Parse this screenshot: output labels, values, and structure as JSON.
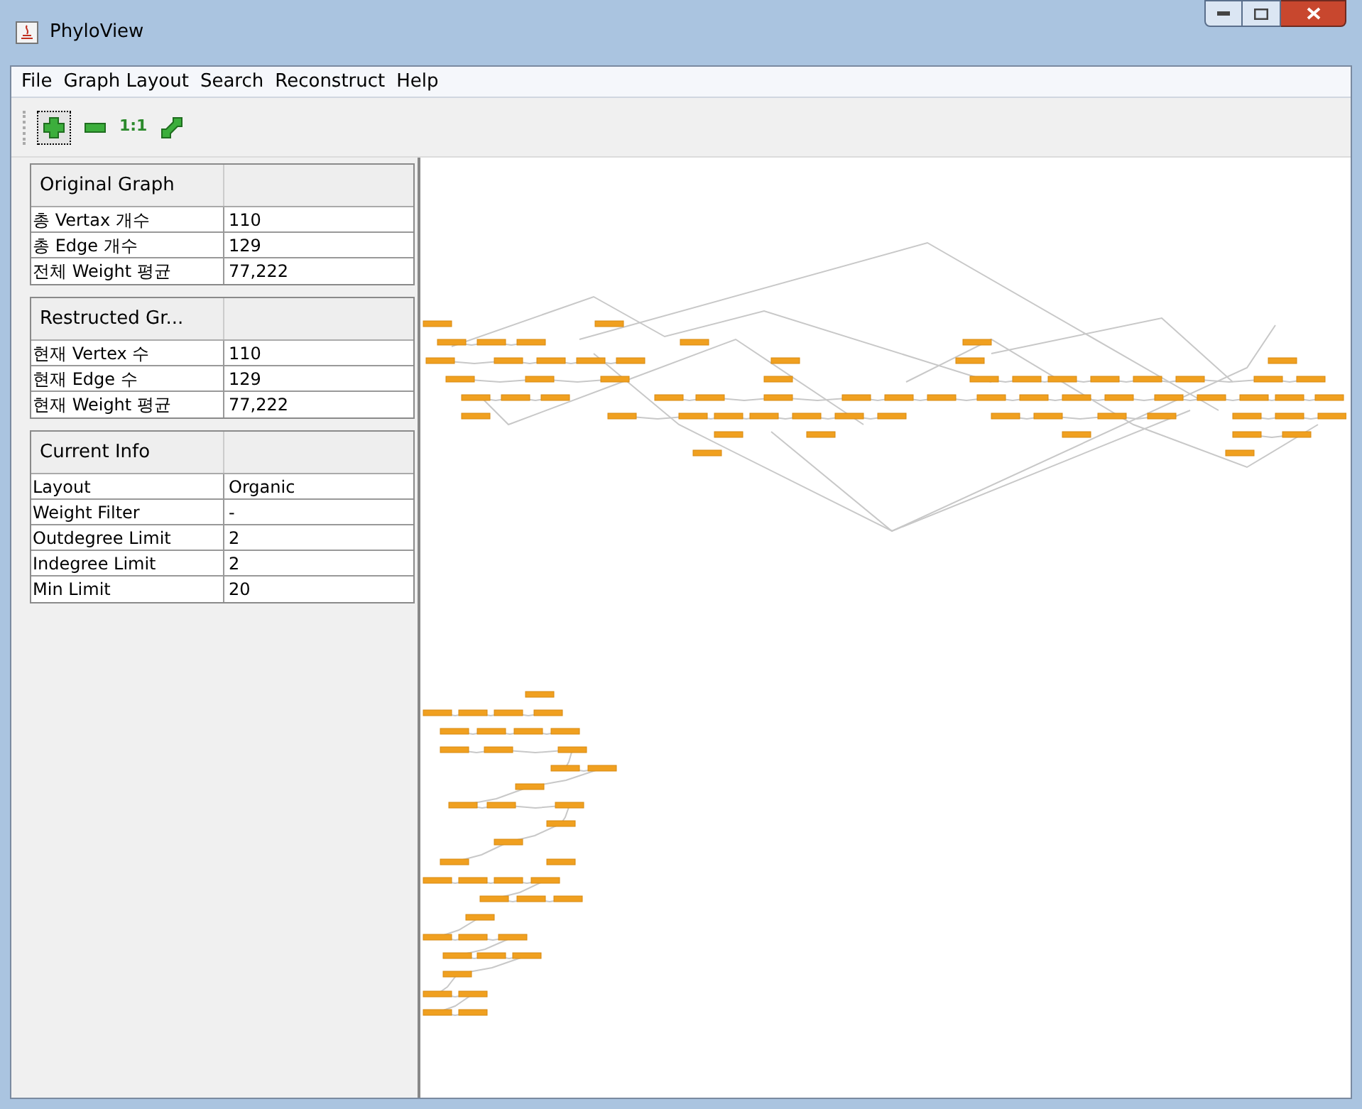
{
  "window": {
    "title": "PhyloView"
  },
  "menu": [
    "File",
    "Graph Layout",
    "Search",
    "Reconstruct",
    "Help"
  ],
  "toolbar": [
    {
      "kind": "zoom-in",
      "selected": true
    },
    {
      "kind": "zoom-out",
      "selected": false
    },
    {
      "kind": "actual-size",
      "label": "1:1",
      "selected": false
    },
    {
      "kind": "fit",
      "selected": false
    }
  ],
  "panels": [
    {
      "title": "Original Graph",
      "rows": [
        {
          "label": "총 Vertax 개수",
          "value": "110"
        },
        {
          "label": "총 Edge 개수",
          "value": "129"
        },
        {
          "label": "전체 Weight 평균",
          "value": "77,222"
        }
      ]
    },
    {
      "title": "Restructed Gr...",
      "rows": [
        {
          "label": "현재 Vertex 수",
          "value": "110"
        },
        {
          "label": "현재 Edge 수",
          "value": "129"
        },
        {
          "label": "현재 Weight 평균",
          "value": "77,222"
        }
      ]
    },
    {
      "title": "Current Info",
      "rows": [
        {
          "label": "Layout",
          "value": "Organic"
        },
        {
          "label": "Weight Filter",
          "value": "-"
        },
        {
          "label": "Outdegree Limit",
          "value": "2"
        },
        {
          "label": "Indegree Limit",
          "value": "2"
        },
        {
          "label": "Min Limit",
          "value": "20"
        }
      ]
    }
  ]
}
